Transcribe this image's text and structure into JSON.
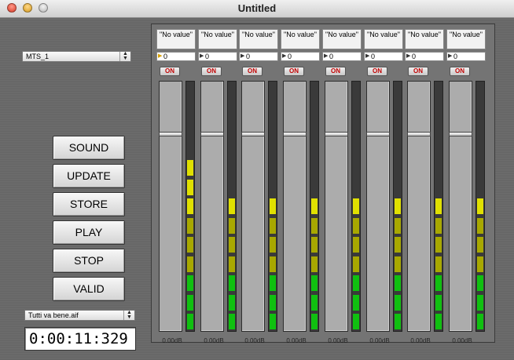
{
  "window": {
    "title": "Untitled"
  },
  "device_select": {
    "value": "MTS_1"
  },
  "transport": {
    "sound": "SOUND",
    "update": "UPDATE",
    "store": "STORE",
    "play": "PLAY",
    "stop": "STOP",
    "valid": "VALID"
  },
  "file_select": {
    "value": "Tutti va bene.aif"
  },
  "timecode": "0:00:11:329",
  "colors": {
    "meter_yellow": "#e0e000",
    "meter_olive": "#a8a800",
    "meter_green": "#10c010",
    "on_text": "#c00000"
  },
  "channels": [
    {
      "name": "\"No value\"",
      "value": "0",
      "on_label": "ON",
      "db": "0.00dB",
      "fader_level": 0.8,
      "meter_segments": 9
    },
    {
      "name": "\"No value\"",
      "value": "0",
      "on_label": "ON",
      "db": "0.00dB",
      "fader_level": 0.8,
      "meter_segments": 7
    },
    {
      "name": "\"No value\"",
      "value": "0",
      "on_label": "ON",
      "db": "0.00dB",
      "fader_level": 0.8,
      "meter_segments": 7
    },
    {
      "name": "\"No value\"",
      "value": "0",
      "on_label": "ON",
      "db": "0.00dB",
      "fader_level": 0.8,
      "meter_segments": 7
    },
    {
      "name": "\"No value\"",
      "value": "0",
      "on_label": "ON",
      "db": "0.00dB",
      "fader_level": 0.8,
      "meter_segments": 7
    },
    {
      "name": "\"No value\"",
      "value": "0",
      "on_label": "ON",
      "db": "0.00dB",
      "fader_level": 0.8,
      "meter_segments": 7
    },
    {
      "name": "\"No value\"",
      "value": "0",
      "on_label": "ON",
      "db": "0.00dB",
      "fader_level": 0.8,
      "meter_segments": 7
    },
    {
      "name": "\"No value\"",
      "value": "0",
      "on_label": "ON",
      "db": "0.00dB",
      "fader_level": 0.8,
      "meter_segments": 7
    }
  ]
}
